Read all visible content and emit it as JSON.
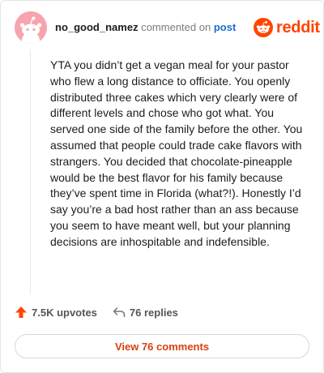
{
  "comment": {
    "username": "no_good_namez",
    "verb": "commented on",
    "post_link": "post",
    "body": "YTA you didn’t get a vegan meal for your pastor who flew a long distance to officiate. You openly distributed three cakes which very clearly were of different levels and chose who got what. You served one side of the family before the other. You assumed that people could trade cake flavors with strangers. You decided that chocolate-pineapple would be the best flavor for his family because they’ve spent time in Florida (what?!). Honestly I’d say you’re a bad host rather than an ass because you seem to have meant well, but your planning decisions are inhospitable and indefensible."
  },
  "brand": {
    "logo_text": "reddit",
    "color": "#ff4500"
  },
  "stats": {
    "upvotes": "7.5K upvotes",
    "replies": "76 replies"
  },
  "actions": {
    "view_comments": "View 76 comments"
  },
  "icons": {
    "avatar": "snoo-avatar-icon",
    "logo": "reddit-logo-icon",
    "upvote": "upvote-arrow-icon",
    "reply": "reply-arrow-icon"
  }
}
